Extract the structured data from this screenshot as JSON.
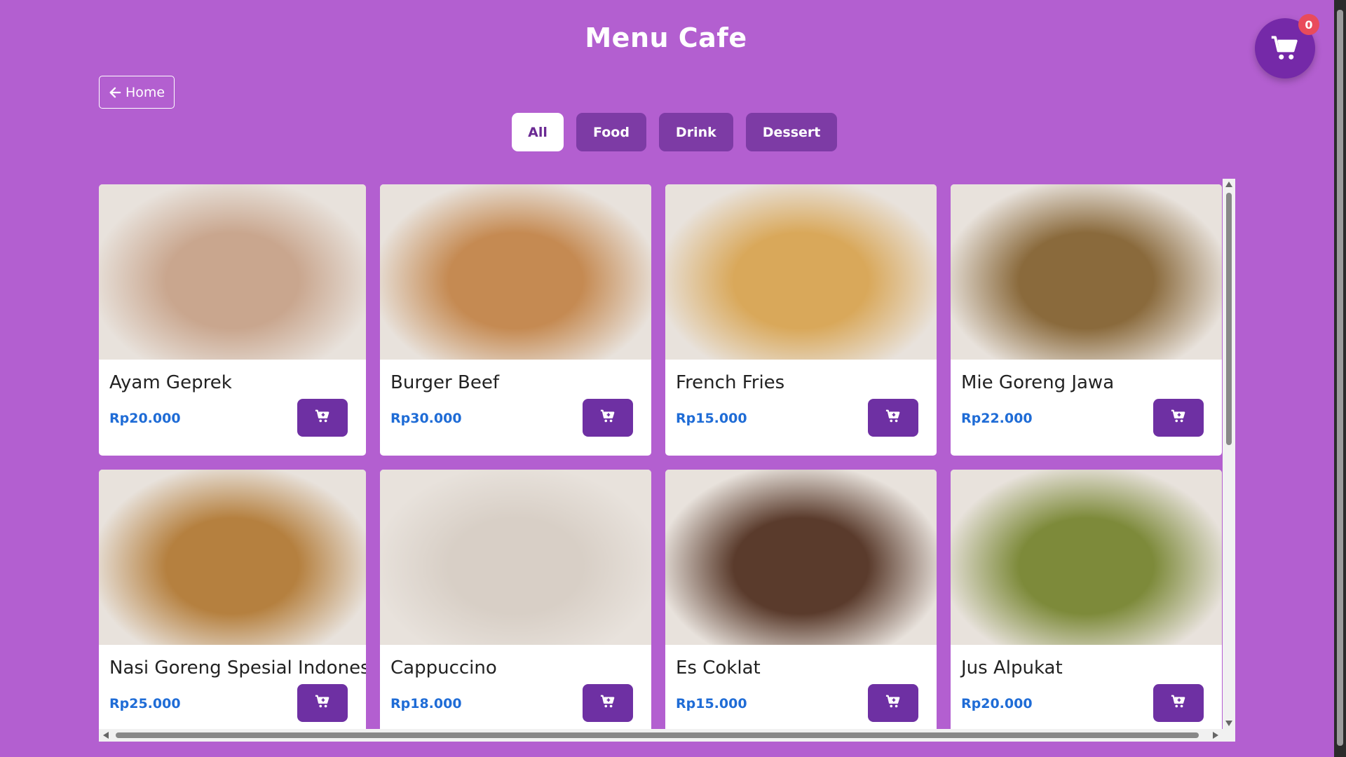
{
  "header": {
    "title": "Menu Cafe",
    "home_label": "Home"
  },
  "filters": [
    {
      "label": "All",
      "active": true
    },
    {
      "label": "Food",
      "active": false
    },
    {
      "label": "Drink",
      "active": false
    },
    {
      "label": "Dessert",
      "active": false
    }
  ],
  "cart": {
    "count": "0",
    "icon": "cart-icon"
  },
  "colors": {
    "background": "#b35fd0",
    "accent": "#6e30a3",
    "price": "#1f6cd6",
    "badge": "#e94b5b"
  },
  "menu": [
    {
      "name": "Ayam Geprek",
      "price": "Rp20.000",
      "photo_tone": "#c9a68e"
    },
    {
      "name": "Burger Beef",
      "price": "Rp30.000",
      "photo_tone": "#c58a52"
    },
    {
      "name": "French Fries",
      "price": "Rp15.000",
      "photo_tone": "#d9a85a"
    },
    {
      "name": "Mie Goreng Jawa",
      "price": "Rp22.000",
      "photo_tone": "#8a6a3c"
    },
    {
      "name": "Nasi Goreng Spesial Indonesia",
      "price": "Rp25.000",
      "photo_tone": "#b5803f"
    },
    {
      "name": "Cappuccino",
      "price": "Rp18.000",
      "photo_tone": "#d8cfc6"
    },
    {
      "name": "Es Coklat",
      "price": "Rp15.000",
      "photo_tone": "#5a3b2c"
    },
    {
      "name": "Jus Alpukat",
      "price": "Rp20.000",
      "photo_tone": "#7d8a3a"
    }
  ]
}
